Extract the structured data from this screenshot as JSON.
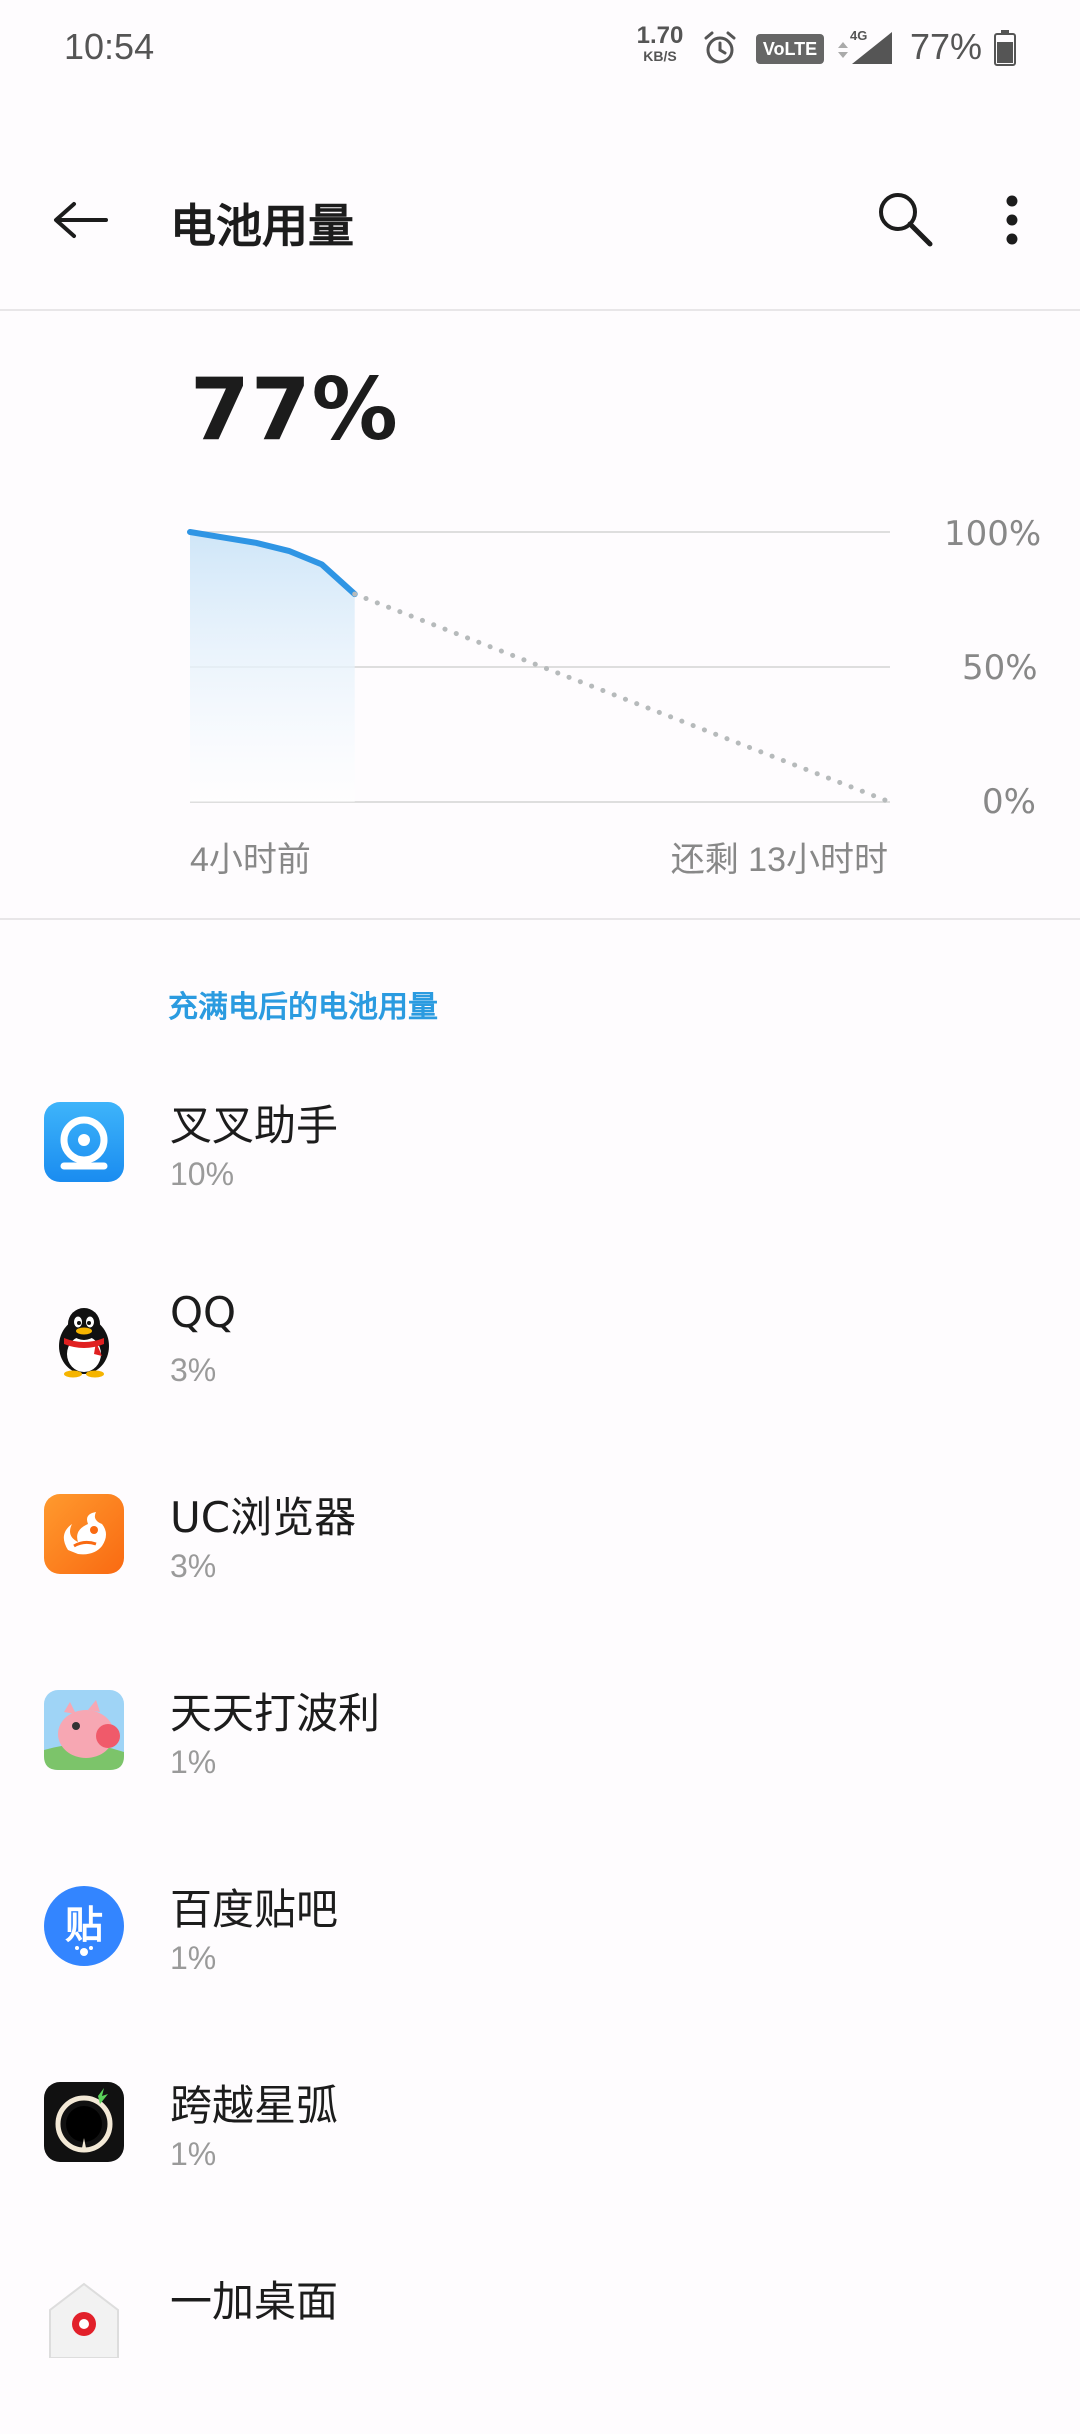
{
  "status_bar": {
    "time": "10:54",
    "net_speed_value": "1.70",
    "net_speed_unit": "KB/S",
    "volte": "VoLTE",
    "network": "4G",
    "battery_percent": "77%",
    "icons": [
      "alarm-icon",
      "signal-icon",
      "battery-icon"
    ]
  },
  "app_bar": {
    "title": "电池用量",
    "icons": [
      "back-arrow-icon",
      "search-icon",
      "more-vert-icon"
    ]
  },
  "battery": {
    "level": "77%",
    "chart_start_label": "4小时前",
    "chart_end_label": "还剩 13小时时"
  },
  "chart_data": {
    "type": "line",
    "y_tick_labels": [
      "100%",
      "50%",
      "0%"
    ],
    "ylim": [
      0,
      100
    ],
    "grid": true,
    "series": [
      {
        "values": [
          100,
          98,
          96,
          93,
          88,
          77
        ],
        "style": "solid"
      },
      {
        "values": [
          77,
          0
        ],
        "style": "dotted"
      }
    ],
    "colors": {
      "line": "#2f95e4",
      "fill": "#d6eaf9",
      "projection": "#b6babb",
      "grid": "#dedede"
    }
  },
  "section": {
    "title": "充满电后的电池用量"
  },
  "apps": [
    {
      "name": "叉叉助手",
      "usage": "10%",
      "icon": "chachazhushou-icon"
    },
    {
      "name": "QQ",
      "usage": "3%",
      "icon": "qq-penguin-icon"
    },
    {
      "name": "UC浏览器",
      "usage": "3%",
      "icon": "uc-browser-icon"
    },
    {
      "name": "天天打波利",
      "usage": "1%",
      "icon": "tiantiandaboli-icon"
    },
    {
      "name": "百度贴吧",
      "usage": "1%",
      "icon": "baidu-tieba-icon"
    },
    {
      "name": "跨越星弧",
      "usage": "1%",
      "icon": "kuayuexinghu-icon"
    },
    {
      "name": "一加桌面",
      "usage": "",
      "icon": "oneplus-launcher-icon"
    }
  ],
  "colors": {
    "accent": "#2b9be0",
    "background": "#fefcfe"
  }
}
